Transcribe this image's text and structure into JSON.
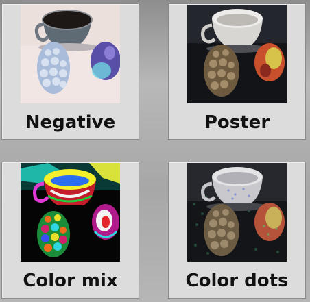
{
  "filters": [
    {
      "id": "negative",
      "label": "Negative"
    },
    {
      "id": "poster",
      "label": "Poster"
    },
    {
      "id": "color-mix",
      "label": "Color mix"
    },
    {
      "id": "color-dots",
      "label": "Color dots"
    }
  ]
}
